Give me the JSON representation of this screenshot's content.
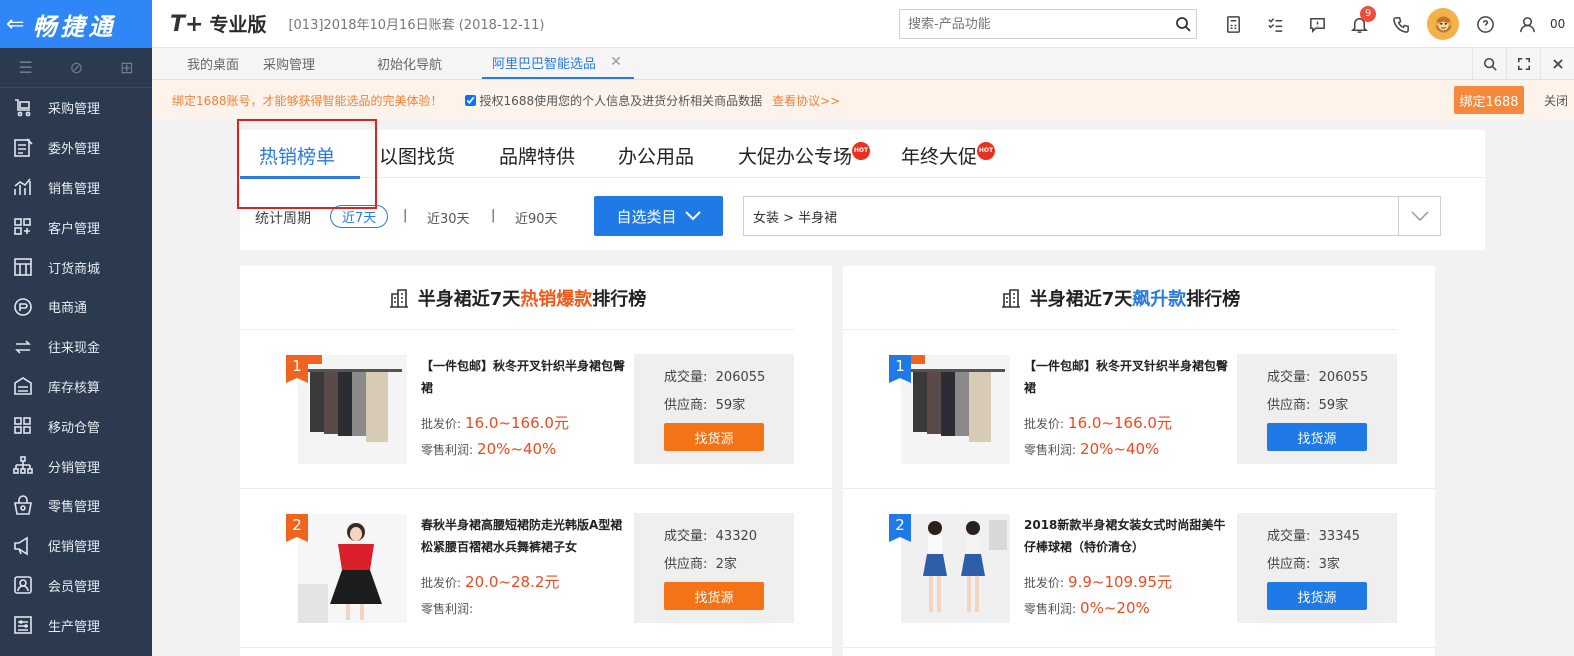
{
  "brand": {
    "name": "畅捷通",
    "back_icon": "arrow-left-icon"
  },
  "sidebar": {
    "items": [
      {
        "label": "采购管理",
        "icon": "purchase-icon"
      },
      {
        "label": "委外管理",
        "icon": "outsource-icon"
      },
      {
        "label": "销售管理",
        "icon": "sales-icon"
      },
      {
        "label": "客户管理",
        "icon": "customer-icon"
      },
      {
        "label": "订货商城",
        "icon": "mall-icon"
      },
      {
        "label": "电商通",
        "icon": "ecommerce-icon"
      },
      {
        "label": "往来现金",
        "icon": "cash-icon"
      },
      {
        "label": "库存核算",
        "icon": "inventory-icon"
      },
      {
        "label": "移动仓管",
        "icon": "mobile-warehouse-icon"
      },
      {
        "label": "分销管理",
        "icon": "distribution-icon"
      },
      {
        "label": "零售管理",
        "icon": "retail-icon"
      },
      {
        "label": "促销管理",
        "icon": "promotion-icon"
      },
      {
        "label": "会员管理",
        "icon": "member-icon"
      },
      {
        "label": "生产管理",
        "icon": "production-icon"
      }
    ]
  },
  "topbar": {
    "logo_t": "T+",
    "edition": "专业版",
    "account": "[013]2018年10月16日账套  (2018-12-11)",
    "search_placeholder": "搜索-产品功能",
    "notification_count": "9",
    "user_code": "00"
  },
  "tabs": [
    {
      "label": "我的桌面"
    },
    {
      "label": "采购管理"
    },
    {
      "label": "初始化导航"
    },
    {
      "label": "阿里巴巴智能选品",
      "active": true
    }
  ],
  "notice": {
    "warning": "绑定1688账号，才能够获得智能选品的完美体验！",
    "consent": "授权1688使用您的个人信息及进货分析相关商品数据",
    "view_agreement": "查看协议>>",
    "bind_button": "绑定1688",
    "close": "关闭"
  },
  "category_tabs": [
    {
      "label": "热销榜单",
      "active": true
    },
    {
      "label": "以图找货"
    },
    {
      "label": "品牌特供"
    },
    {
      "label": "办公用品"
    },
    {
      "label": "大促办公专场",
      "hot": true
    },
    {
      "label": "年终大促",
      "hot": true
    }
  ],
  "hot_badge": "HOT",
  "period": {
    "label": "统计周期",
    "options": [
      "近7天",
      "近30天",
      "近90天"
    ],
    "separator": "|",
    "selected": "近7天"
  },
  "choose_category_button": "自选类目",
  "category_value": "女装 > 半身裙",
  "rank_hot": {
    "title_prefix": "半身裙近7天",
    "title_highlight": "热销爆款",
    "title_suffix": "排行榜",
    "items": [
      {
        "rank": "1",
        "name": "【一件包邮】秋冬开叉针织半身裙包臀裙",
        "price_label": "批发价:",
        "price": "16.0~166.0元",
        "profit_label": "零售利润:",
        "profit": "20%~40%",
        "volume_label": "成交量:",
        "volume": "206055",
        "supplier_label": "供应商:",
        "supplier": "59家",
        "button": "找货源"
      },
      {
        "rank": "2",
        "name": "春秋半身裙高腰短裙防走光韩版A型裙松紧腰百褶裙水兵舞裤裙子女",
        "price_label": "批发价:",
        "price": "20.0~28.2元",
        "profit_label": "零售利润:",
        "profit": "",
        "volume_label": "成交量:",
        "volume": "43320",
        "supplier_label": "供应商:",
        "supplier": "2家",
        "button": "找货源"
      }
    ]
  },
  "rank_rising": {
    "title_prefix": "半身裙近7天",
    "title_highlight": "飙升款",
    "title_suffix": "排行榜",
    "items": [
      {
        "rank": "1",
        "name": "【一件包邮】秋冬开叉针织半身裙包臀裙",
        "price_label": "批发价:",
        "price": "16.0~166.0元",
        "profit_label": "零售利润:",
        "profit": "20%~40%",
        "volume_label": "成交量:",
        "volume": "206055",
        "supplier_label": "供应商:",
        "supplier": "59家",
        "button": "找货源"
      },
      {
        "rank": "2",
        "name": "2018新款半身裙女装女式时尚甜美牛仔棒球裙（特价清仓）",
        "price_label": "批发价:",
        "price": "9.9~109.95元",
        "profit_label": "零售利润:",
        "profit": "0%~20%",
        "volume_label": "成交量:",
        "volume": "33345",
        "supplier_label": "供应商:",
        "supplier": "3家",
        "button": "找货源"
      }
    ]
  },
  "colors": {
    "sidebar_bg": "#2c3a4f",
    "brand_blue": "#2f86f6",
    "accent_orange": "#f57317",
    "accent_blue": "#1f7ae8",
    "price_red": "#f0481e"
  }
}
